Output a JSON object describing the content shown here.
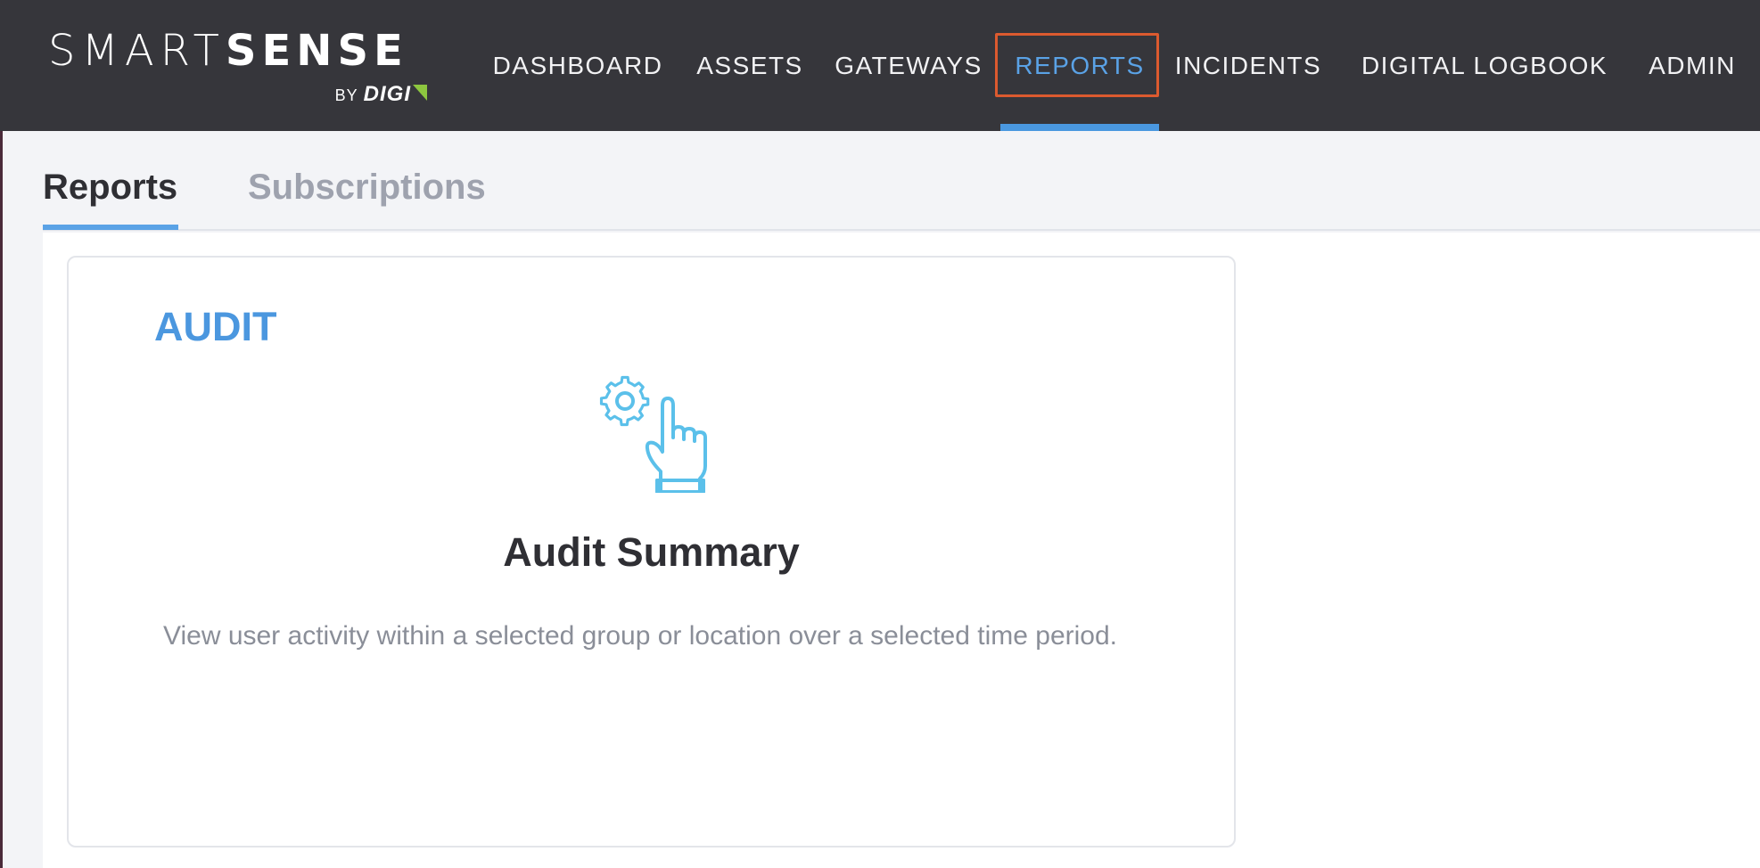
{
  "header": {
    "logo": {
      "brand_light": "SMART",
      "brand_bold": "SENSE",
      "by": "BY",
      "company": "DIGI"
    },
    "nav": [
      {
        "label": "DASHBOARD",
        "active": false
      },
      {
        "label": "ASSETS",
        "active": false
      },
      {
        "label": "GATEWAYS",
        "active": false
      },
      {
        "label": "REPORTS",
        "active": true
      },
      {
        "label": "INCIDENTS",
        "active": false
      },
      {
        "label": "DIGITAL LOGBOOK",
        "active": false
      },
      {
        "label": "ADMIN",
        "active": false
      }
    ]
  },
  "tabs": [
    {
      "label": "Reports",
      "active": true
    },
    {
      "label": "Subscriptions",
      "active": false
    }
  ],
  "report_card": {
    "category": "AUDIT",
    "icon": "gear-hand-pointer-icon",
    "title": "Audit Summary",
    "description": "View user activity within a selected group or location over a selected time period."
  },
  "colors": {
    "accent": "#4b97df",
    "nav_background": "#36363b",
    "highlight_box": "#dc5a2f",
    "icon": "#5bc0ea",
    "logo_mark": "#8dc63f"
  }
}
